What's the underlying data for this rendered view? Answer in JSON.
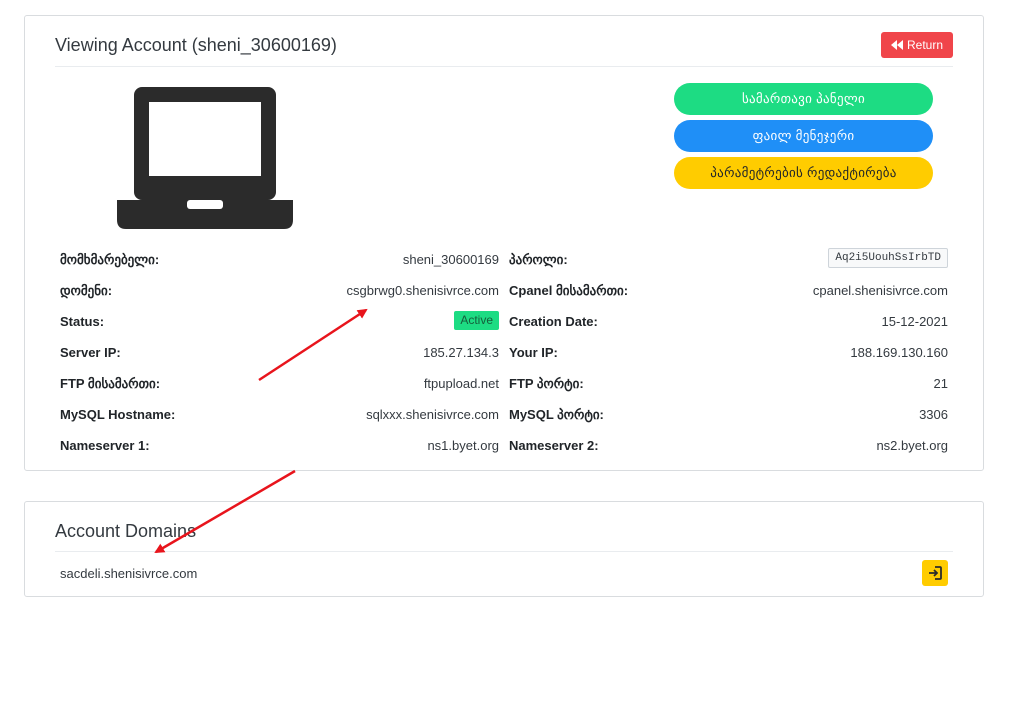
{
  "account_card": {
    "title": "Viewing Account (sheni_30600169)",
    "return_label": "Return",
    "buttons": {
      "control_panel": "სამართავი პანელი",
      "file_manager": "ფაილ მენეჯერი",
      "edit_settings": "პარამეტრების რედაქტირება"
    },
    "left_rows": [
      {
        "label": "მომხმარებელი:",
        "value": "sheni_30600169"
      },
      {
        "label": "დომენი:",
        "value": "csgbrwg0.shenisivrce.com"
      },
      {
        "label": "Status:",
        "value": "Active"
      },
      {
        "label": "Server IP:",
        "value": "185.27.134.3"
      },
      {
        "label": "FTP მისამართი:",
        "value": "ftpupload.net"
      },
      {
        "label": "MySQL Hostname:",
        "value": "sqlxxx.shenisivrce.com"
      },
      {
        "label": "Nameserver 1:",
        "value": "ns1.byet.org"
      }
    ],
    "right_rows": [
      {
        "label": "პაროლი:",
        "value": "Aq2i5UouhSsIrbTD"
      },
      {
        "label": "Cpanel მისამართი:",
        "value": "cpanel.shenisivrce.com"
      },
      {
        "label": "Creation Date:",
        "value": "15-12-2021"
      },
      {
        "label": "Your IP:",
        "value": "188.169.130.160"
      },
      {
        "label": "FTP პორტი:",
        "value": "21"
      },
      {
        "label": "MySQL პორტი:",
        "value": "3306"
      },
      {
        "label": "Nameserver 2:",
        "value": "ns2.byet.org"
      }
    ]
  },
  "domains_card": {
    "title": "Account Domains",
    "domains": [
      "sacdeli.shenisivrce.com"
    ]
  },
  "colors": {
    "green": "#1ddc83",
    "blue": "#1f8ff7",
    "yellow": "#ffcc00",
    "red": "#f0454a",
    "annotation": "#e8141c"
  },
  "icons": [
    "laptop-icon",
    "rewind-icon",
    "login-icon"
  ]
}
